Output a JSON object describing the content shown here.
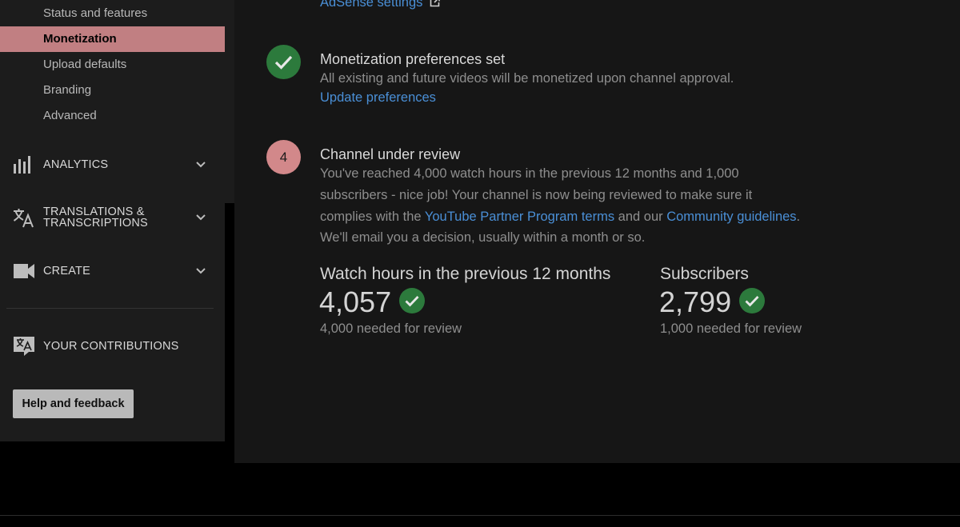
{
  "sidebar": {
    "sub_items": [
      {
        "label": "Status and features",
        "active": false
      },
      {
        "label": "Monetization",
        "active": true
      },
      {
        "label": "Upload defaults",
        "active": false
      },
      {
        "label": "Branding",
        "active": false
      },
      {
        "label": "Advanced",
        "active": false
      }
    ],
    "sections": [
      {
        "label": "ANALYTICS",
        "icon": "bar-chart-icon"
      },
      {
        "label_line1": "TRANSLATIONS &",
        "label_line2": "TRANSCRIPTIONS",
        "icon": "translate-icon"
      },
      {
        "label": "CREATE",
        "icon": "video-camera-icon"
      }
    ],
    "contributions": {
      "label": "YOUR CONTRIBUTIONS",
      "icon": "translate-bubble-icon"
    },
    "help_button": "Help and feedback"
  },
  "main": {
    "adsense_link": "AdSense settings",
    "step_preferences": {
      "title": "Monetization preferences set",
      "description": "All existing and future videos will be monetized upon channel approval.",
      "link": "Update preferences"
    },
    "step_review": {
      "number": "4",
      "title": "Channel under review",
      "line1": "You've reached 4,000 watch hours in the previous 12 months and 1,000",
      "line2": "subscribers - nice job! Your channel is now being reviewed to make sure it",
      "line3_pre": "complies with the ",
      "line3_link1": "YouTube Partner Program terms",
      "line3_mid": " and our ",
      "line3_link2": "Community guidelines",
      "line3_post": ".",
      "line4": "We'll email you a decision, usually within a month or so."
    },
    "stats": [
      {
        "title": "Watch hours in the previous 12 months",
        "value": "4,057",
        "needed": "4,000 needed for review"
      },
      {
        "title": "Subscribers",
        "value": "2,799",
        "needed": "1,000 needed for review"
      }
    ]
  },
  "colors": {
    "active_item": "#c17f82",
    "link": "#4a8fd6",
    "check_green": "#2c7a3c",
    "step_number_bg": "#d2888a"
  }
}
